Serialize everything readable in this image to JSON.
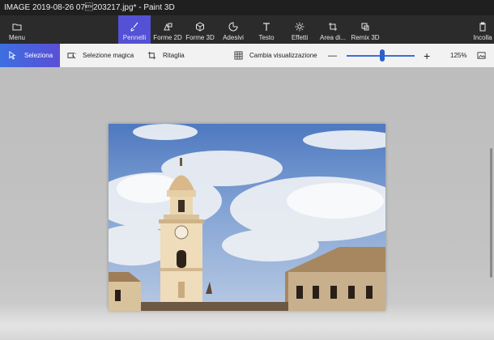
{
  "window": {
    "title": "IMAGE 2019-08-26 07\u0003203217.jpg* - Paint 3D"
  },
  "ribbon": {
    "menu_label": "Menu",
    "tools": [
      {
        "label": "Pennelli",
        "icon": "brush-icon",
        "active": true
      },
      {
        "label": "Forme 2D",
        "icon": "shapes-2d-icon"
      },
      {
        "label": "Forme 3D",
        "icon": "cube-icon"
      },
      {
        "label": "Adesivi",
        "icon": "sticker-icon"
      },
      {
        "label": "Testo",
        "icon": "text-icon"
      },
      {
        "label": "Effetti",
        "icon": "sun-icon"
      },
      {
        "label": "Area di...",
        "icon": "crop-icon"
      },
      {
        "label": "Remix 3D",
        "icon": "remix-icon"
      }
    ],
    "paste_label": "Incolla"
  },
  "toolbar": {
    "select_label": "Seleziona",
    "magic_select_label": "Selezione magica",
    "crop_label": "Ritaglia",
    "view_toggle_label": "Cambia visualizzazione",
    "zoom_minus": "—",
    "zoom_plus": "+",
    "zoom_level": "125%",
    "zoom_fraction": 0.52
  },
  "colors": {
    "accent": "#5451d6",
    "ribbon_bg": "#2b2b2b",
    "titlebar_bg": "#1f1f1f",
    "slider": "#2e5fc9"
  }
}
